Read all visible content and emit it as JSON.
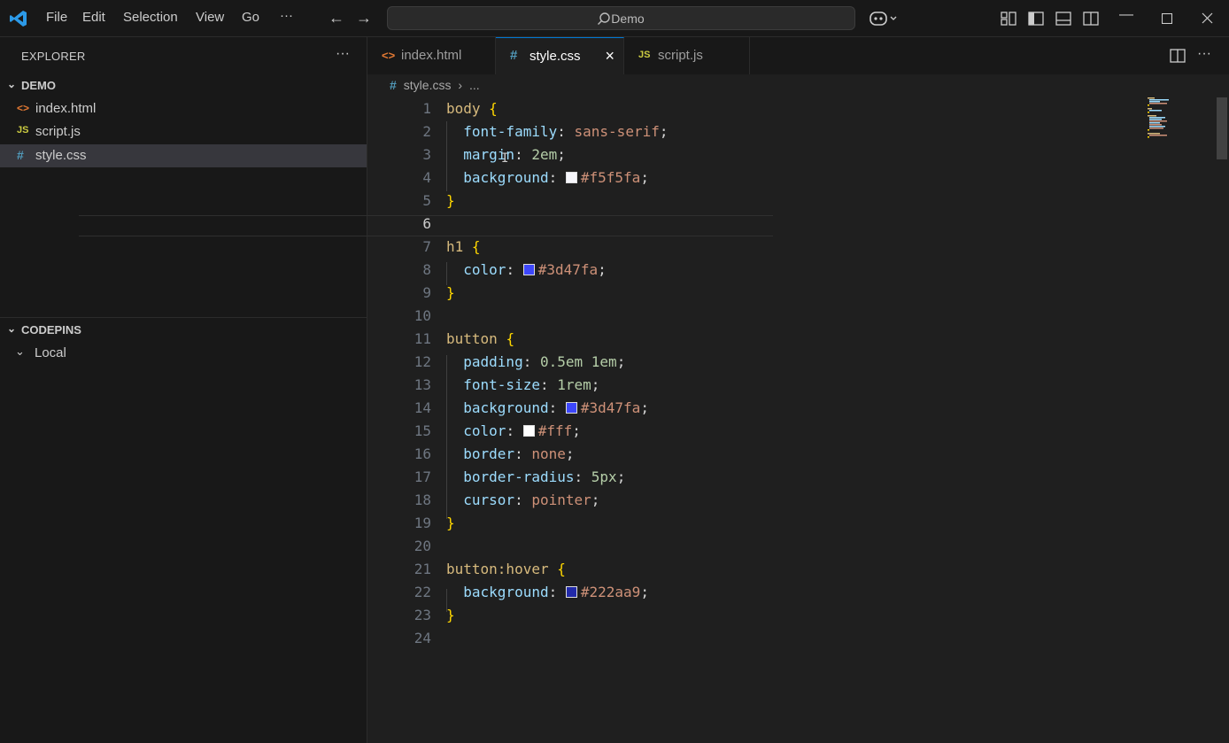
{
  "titlebar": {
    "menu": [
      "File",
      "Edit",
      "Selection",
      "View",
      "Go"
    ],
    "more": "···",
    "search_text": "Demo"
  },
  "sidebar": {
    "title": "EXPLORER",
    "more": "···",
    "folder": "DEMO",
    "files": [
      {
        "icon": "<>",
        "name": "index.html",
        "color": "#e37933"
      },
      {
        "icon": "JS",
        "name": "script.js",
        "color": "#cbcb41"
      },
      {
        "icon": "#",
        "name": "style.css",
        "color": "#519aba"
      }
    ],
    "codepins": "CODEPINS",
    "local": "Local"
  },
  "tabs": [
    {
      "icon": "<>",
      "name": "index.html",
      "color": "#e37933"
    },
    {
      "icon": "#",
      "name": "style.css",
      "color": "#519aba"
    },
    {
      "icon": "JS",
      "name": "script.js",
      "color": "#cbcb41"
    }
  ],
  "breadcrumb": {
    "file": "style.css",
    "rest": "..."
  },
  "code": {
    "line_numbers": [
      "1",
      "2",
      "3",
      "4",
      "5",
      "6",
      "7",
      "8",
      "9",
      "10",
      "11",
      "12",
      "13",
      "14",
      "15",
      "16",
      "17",
      "18",
      "19",
      "20",
      "21",
      "22",
      "23",
      "24"
    ],
    "body_sel": "body",
    "ob": "{",
    "cb": "}",
    "font_family_prop": "font-family",
    "font_family_val": "sans-serif",
    "margin_prop": "margin",
    "margin_val": "2em",
    "background_prop": "background",
    "bg_body_val": "#f5f5fa",
    "h1_sel": "h1",
    "color_prop": "color",
    "h1_color_val": "#3d47fa",
    "button_sel": "button",
    "padding_prop": "padding",
    "padding_val": "0.5em 1em",
    "font_size_prop": "font-size",
    "font_size_val": "1rem",
    "btn_bg_val": "#3d47fa",
    "btn_color_val": "#fff",
    "border_prop": "border",
    "border_val": "none",
    "border_radius_prop": "border-radius",
    "border_radius_val": "5px",
    "cursor_prop": "cursor",
    "cursor_val": "pointer",
    "hover_sel": "button:hover",
    "hover_bg_val": "#222aa9",
    "colon": ":",
    "semi": ";"
  },
  "colors": {
    "accent": "#0078d4",
    "swatch_body": "#f5f5fa",
    "swatch_blue": "#3d47fa",
    "swatch_white": "#ffffff",
    "swatch_dark": "#222aa9"
  }
}
